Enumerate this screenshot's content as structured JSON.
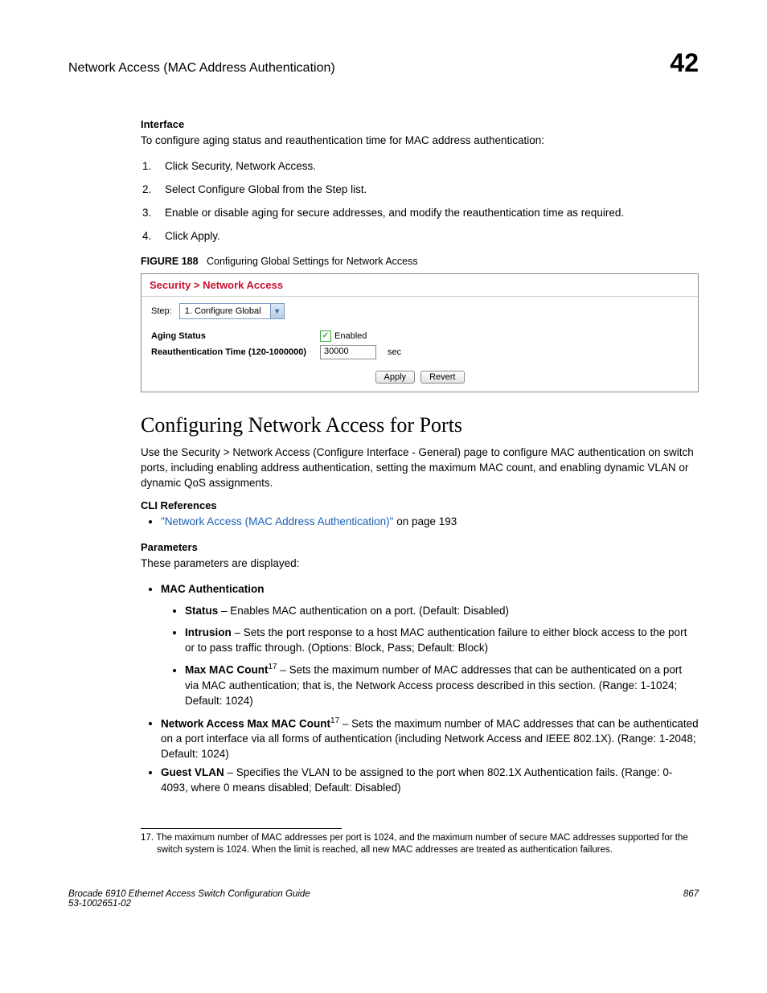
{
  "header": {
    "left": "Network Access (MAC Address Authentication)",
    "right": "42"
  },
  "interface": {
    "label": "Interface",
    "intro": "To configure aging status and reauthentication time for MAC address authentication:",
    "steps": [
      "Click Security, Network Access.",
      "Select Configure Global from the Step list.",
      "Enable or disable aging for secure addresses, and modify the reauthentication time as required.",
      "Click Apply."
    ]
  },
  "figure": {
    "label": "FIGURE 188",
    "caption": "Configuring Global Settings for Network Access",
    "panel": {
      "title": "Security > Network Access",
      "step_label": "Step:",
      "step_value": "1. Configure Global",
      "rows": {
        "aging_label": "Aging Status",
        "aging_value": "Enabled",
        "reauth_label": "Reauthentication Time (120-1000000)",
        "reauth_value": "30000",
        "reauth_unit": "sec"
      },
      "buttons": {
        "apply": "Apply",
        "revert": "Revert"
      }
    }
  },
  "section2": {
    "heading": "Configuring Network Access for Ports",
    "intro": "Use the Security > Network Access (Configure Interface - General) page to configure MAC authentication on switch ports, including enabling address authentication, setting the maximum MAC count, and enabling dynamic VLAN or dynamic QoS assignments.",
    "cli_label": "CLI References",
    "cli_link": "\"Network Access (MAC Address Authentication)\"",
    "cli_tail": " on page 193",
    "params_label": "Parameters",
    "params_intro": "These parameters are displayed:",
    "mac_auth_label": "MAC Authentication",
    "mac_auth_items": [
      {
        "name": "Status",
        "desc": " – Enables MAC authentication on a port. (Default: Disabled)"
      },
      {
        "name": "Intrusion",
        "desc": " – Sets the port response to a host MAC authentication failure to either block access to the port or to pass traffic through. (Options: Block, Pass; Default: Block)"
      },
      {
        "name": "Max MAC Count",
        "sup": "17",
        "desc": " – Sets the maximum number of MAC addresses that can be authenticated on a port via MAC authentication; that is, the Network Access process described in this section. (Range: 1-1024; Default: 1024)"
      }
    ],
    "top_items": [
      {
        "name": "Network Access Max MAC Count",
        "sup": "17",
        "desc": " – Sets the maximum number of MAC addresses that can be authenticated on a port interface via all forms of authentication (including Network Access and IEEE 802.1X). (Range: 1-2048; Default: 1024)"
      },
      {
        "name": "Guest VLAN",
        "desc": " – Specifies the VLAN to be assigned to the port when 802.1X Authentication fails. (Range: 0-4093, where 0 means disabled; Default: Disabled)"
      }
    ]
  },
  "footnote": {
    "num": "17.",
    "text": "The maximum number of MAC addresses per port is 1024, and the maximum number of secure MAC addresses supported for the switch system is 1024. When the limit is reached, all new MAC addresses are treated as authentication failures."
  },
  "footer": {
    "left1": "Brocade 6910 Ethernet Access Switch Configuration Guide",
    "left2": "53-1002651-02",
    "right": "867"
  }
}
